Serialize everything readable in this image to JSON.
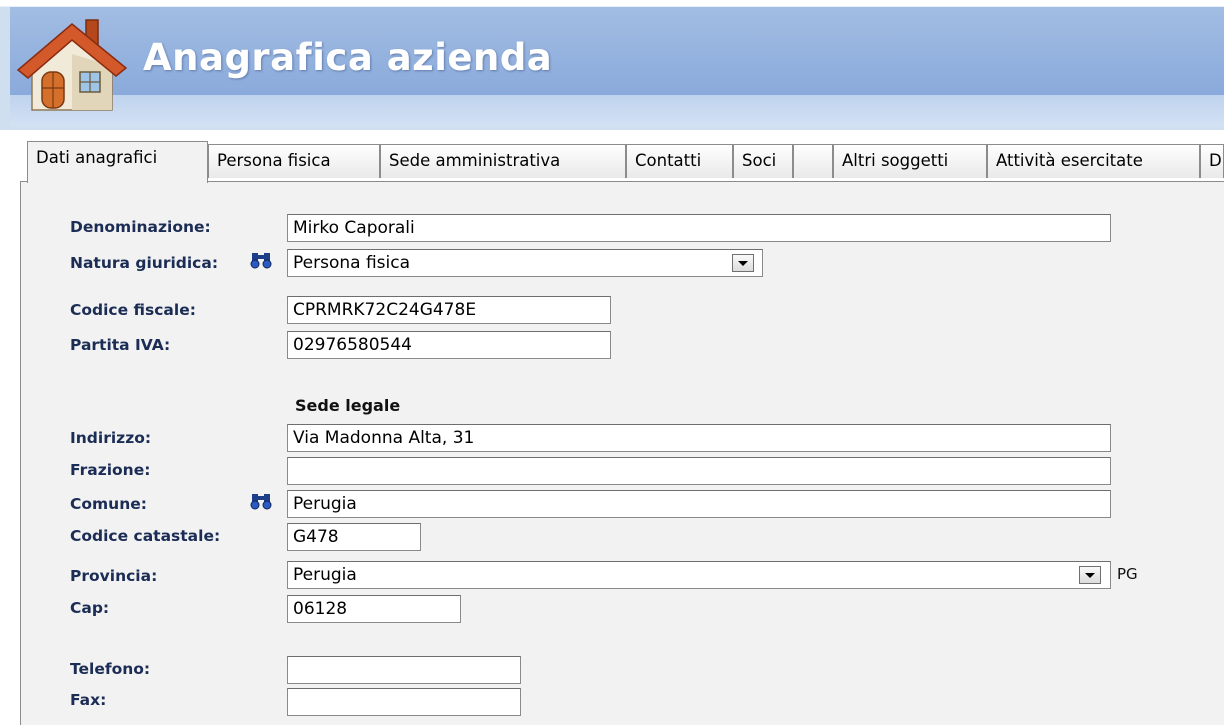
{
  "app": {
    "title": "Anagrafica azienda"
  },
  "tabs": [
    {
      "label": "Dati anagrafici"
    },
    {
      "label": "Persona fisica"
    },
    {
      "label": "Sede amministrativa"
    },
    {
      "label": "Contatti"
    },
    {
      "label": "Soci"
    },
    {
      "label": ""
    },
    {
      "label": "Altri soggetti"
    },
    {
      "label": "Attività esercitate"
    },
    {
      "label": "D"
    }
  ],
  "form": {
    "denominazione": {
      "label": "Denominazione:",
      "value": "Mirko Caporali"
    },
    "natura": {
      "label": "Natura giuridica:",
      "value": "Persona fisica"
    },
    "codice_fiscale": {
      "label": "Codice fiscale:",
      "value": "CPRMRK72C24G478E"
    },
    "partita_iva": {
      "label": "Partita IVA:",
      "value": "02976580544"
    },
    "sede_legale_title": "Sede legale",
    "indirizzo": {
      "label": "Indirizzo:",
      "value": "Via Madonna Alta, 31"
    },
    "frazione": {
      "label": "Frazione:",
      "value": ""
    },
    "comune": {
      "label": "Comune:",
      "value": "Perugia"
    },
    "codice_catastale": {
      "label": "Codice catastale:",
      "value": "G478"
    },
    "provincia": {
      "label": "Provincia:",
      "value": "Perugia",
      "sigla": "PG"
    },
    "cap": {
      "label": "Cap:",
      "value": "06128"
    },
    "telefono": {
      "label": "Telefono:",
      "value": ""
    },
    "fax": {
      "label": "Fax:",
      "value": ""
    }
  },
  "icons": {
    "app_icon": "house-icon",
    "lookup_icon": "binoculars-icon",
    "dropdown_icon": "chevron-down-icon"
  },
  "colors": {
    "header_blue": "#8aaadb",
    "label_navy": "#1b2c55",
    "panel_bg": "#f2f2f2"
  }
}
